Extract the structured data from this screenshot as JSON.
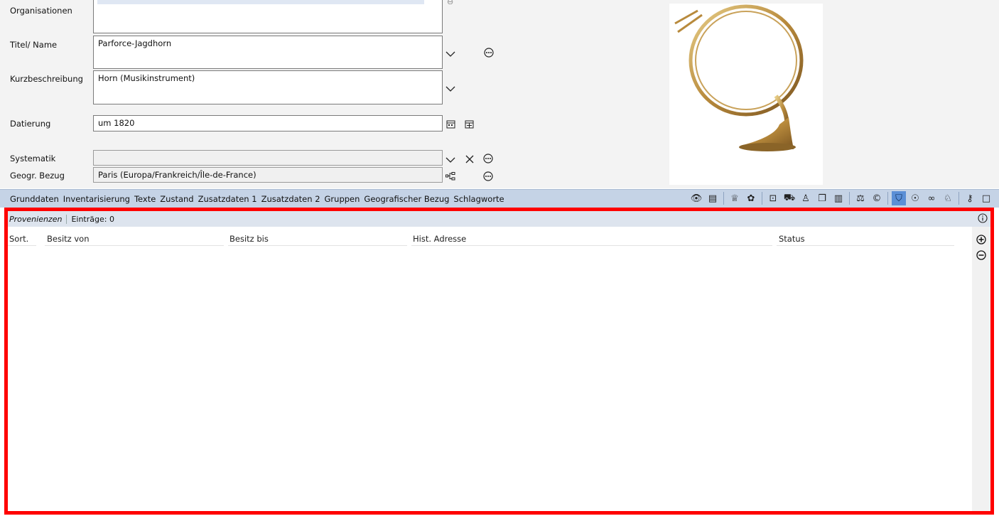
{
  "form": {
    "organisationen": {
      "label": "Organisationen"
    },
    "titel": {
      "label": "Titel/ Name",
      "value": "Parforce-Jagdhorn"
    },
    "kurz": {
      "label": "Kurzbeschreibung",
      "value": "Horn (Musikinstrument)"
    },
    "datierung": {
      "label": "Datierung",
      "value": "um 1820"
    },
    "systematik": {
      "label": "Systematik",
      "value": ""
    },
    "geogr": {
      "label": "Geogr. Bezug",
      "value": "Paris (Europa/Frankreich/Île-de-France)"
    }
  },
  "tabs": [
    "Grunddaten",
    "Inventarisierung",
    "Texte",
    "Zustand",
    "Zusatzdaten 1",
    "Zusatzdaten 2",
    "Gruppen",
    "Geografischer Bezug",
    "Schlagworte"
  ],
  "toolbar_icons": [
    {
      "name": "eye-icon",
      "glyph": "👁"
    },
    {
      "name": "document-icon",
      "glyph": "▤"
    },
    {
      "name": "award-icon",
      "glyph": "♕"
    },
    {
      "name": "palette-icon",
      "glyph": "✿"
    },
    {
      "name": "box-icon",
      "glyph": "⊡"
    },
    {
      "name": "transport-icon",
      "glyph": "⛟"
    },
    {
      "name": "person-icon",
      "glyph": "♙"
    },
    {
      "name": "copy-icon",
      "glyph": "❐"
    },
    {
      "name": "book-icon",
      "glyph": "▥"
    },
    {
      "name": "scale-icon",
      "glyph": "⚖"
    },
    {
      "name": "copyright-icon",
      "glyph": "©"
    },
    {
      "name": "shield-icon",
      "glyph": "⛉"
    },
    {
      "name": "money-bag-icon",
      "glyph": "☉"
    },
    {
      "name": "link-icon",
      "glyph": "∞"
    },
    {
      "name": "user-abc-icon",
      "glyph": "♘"
    },
    {
      "name": "key-icon",
      "glyph": "⚷"
    },
    {
      "name": "window-icon",
      "glyph": "□"
    }
  ],
  "provenienzen": {
    "title": "Provenienzen",
    "count_label": "Einträge:",
    "count": "0",
    "columns": [
      "Sort.",
      "Besitz von",
      "Besitz bis",
      "Hist. Adresse",
      "Status"
    ]
  }
}
